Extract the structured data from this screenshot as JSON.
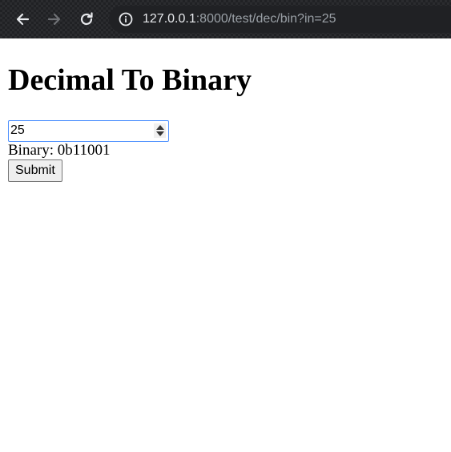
{
  "browser": {
    "url_host": "127.0.0.1",
    "url_rest": ":8000/test/dec/bin?in=25",
    "icons": {
      "back": "back-arrow-icon",
      "forward": "forward-arrow-icon",
      "reload": "reload-icon",
      "info": "info-icon"
    }
  },
  "page": {
    "title": "Decimal To Binary",
    "input_value": "25",
    "result_label": "Binary:",
    "result_value": "0b11001",
    "submit_label": "Submit"
  }
}
